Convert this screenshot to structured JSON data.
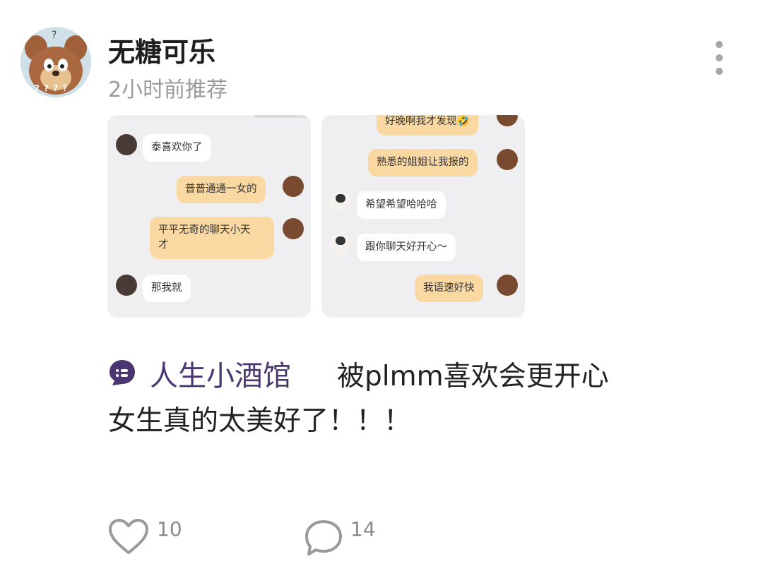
{
  "post": {
    "author": {
      "name": "无糖可乐",
      "avatar_icon": "cartoon-mouse-avatar-icon",
      "avatar_marks": "? ? ? ?"
    },
    "time_text": "2小时前推荐",
    "more_icon": "vertical-dots-icon",
    "images": [
      {
        "messages": [
          {
            "side": "in",
            "text": "泰喜欢你了"
          },
          {
            "side": "out",
            "text": "普普通通一女的"
          },
          {
            "side": "out",
            "text": "平平无奇的聊天小天\n才"
          },
          {
            "side": "in",
            "text": "那我就"
          }
        ]
      },
      {
        "messages": [
          {
            "side": "out",
            "text": "好晚啊我才发现🤣"
          },
          {
            "side": "out",
            "text": "熟悉的姐姐让我报的"
          },
          {
            "side": "in",
            "text": "希望希望哈哈哈"
          },
          {
            "side": "in",
            "text": "跟你聊天好开心～"
          },
          {
            "side": "out",
            "text": "我语速好快"
          }
        ]
      }
    ],
    "topic": {
      "icon": "chat-bubble-topic-icon",
      "name": "人生小酒馆",
      "color": "#4a3670"
    },
    "content_line1": "被plmm喜欢会更开心",
    "content_line2": "女生真的太美好了！！！",
    "actions": {
      "like": {
        "icon": "heart-icon",
        "count": "10"
      },
      "comment": {
        "icon": "comment-icon",
        "count": "14"
      }
    }
  }
}
